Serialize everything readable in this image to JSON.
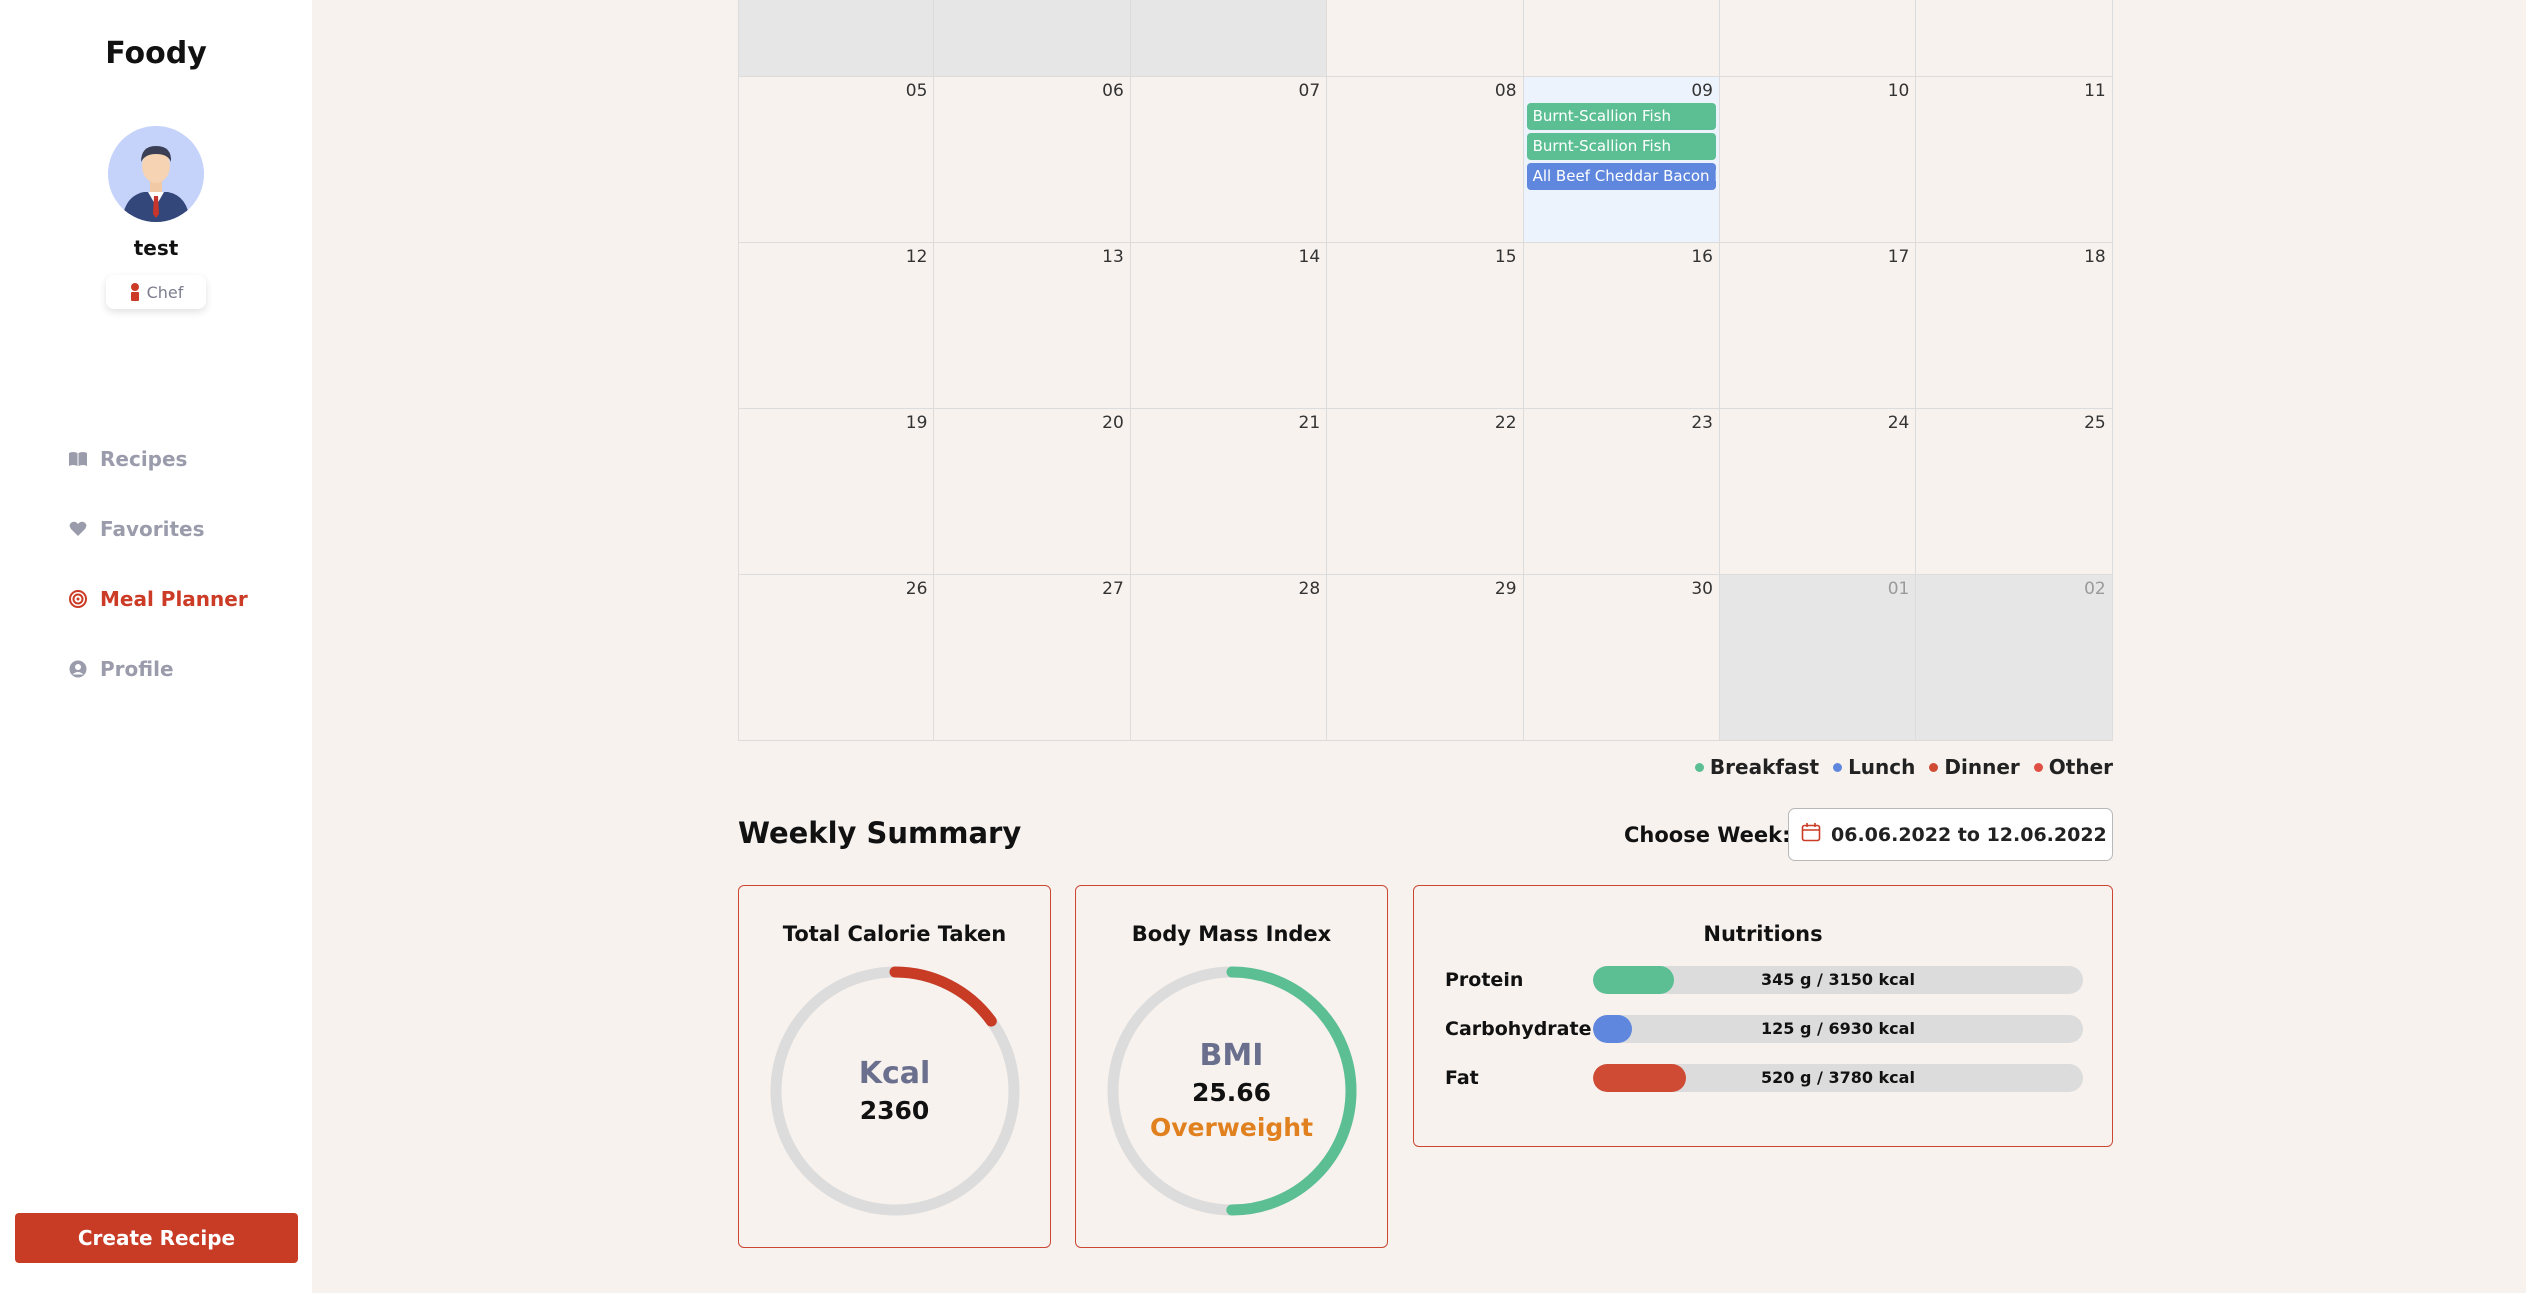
{
  "app": {
    "name": "Foody"
  },
  "user": {
    "name": "test",
    "role": "Chef"
  },
  "nav": [
    {
      "label": "Recipes",
      "icon": "book-icon",
      "active": false
    },
    {
      "label": "Favorites",
      "icon": "heart-icon",
      "active": false
    },
    {
      "label": "Meal Planner",
      "icon": "target-icon",
      "active": true
    },
    {
      "label": "Profile",
      "icon": "user-circle-icon",
      "active": false
    }
  ],
  "create_recipe_label": "Create Recipe",
  "calendar": {
    "weeks": [
      [
        {
          "day": "",
          "other": true
        },
        {
          "day": "",
          "other": true
        },
        {
          "day": "",
          "other": true
        },
        {
          "day": ""
        },
        {
          "day": ""
        },
        {
          "day": ""
        },
        {
          "day": ""
        }
      ],
      [
        {
          "day": "05"
        },
        {
          "day": "06"
        },
        {
          "day": "07"
        },
        {
          "day": "08"
        },
        {
          "day": "09",
          "today": true,
          "events": [
            {
              "title": "Burnt-Scallion Fish",
              "type": "Breakfast"
            },
            {
              "title": "Burnt-Scallion Fish",
              "type": "Breakfast"
            },
            {
              "title": "All Beef Cheddar Bacon Burger",
              "type": "Lunch"
            }
          ]
        },
        {
          "day": "10"
        },
        {
          "day": "11"
        }
      ],
      [
        {
          "day": "12"
        },
        {
          "day": "13"
        },
        {
          "day": "14"
        },
        {
          "day": "15"
        },
        {
          "day": "16"
        },
        {
          "day": "17"
        },
        {
          "day": "18"
        }
      ],
      [
        {
          "day": "19"
        },
        {
          "day": "20"
        },
        {
          "day": "21"
        },
        {
          "day": "22"
        },
        {
          "day": "23"
        },
        {
          "day": "24"
        },
        {
          "day": "25"
        }
      ],
      [
        {
          "day": "26"
        },
        {
          "day": "27"
        },
        {
          "day": "28"
        },
        {
          "day": "29"
        },
        {
          "day": "30"
        },
        {
          "day": "01",
          "other": true
        },
        {
          "day": "02",
          "other": true
        }
      ]
    ]
  },
  "legend": [
    {
      "label": "Breakfast",
      "color": "#5cbf94"
    },
    {
      "label": "Lunch",
      "color": "#5f87de"
    },
    {
      "label": "Dinner",
      "color": "#cf4b33"
    },
    {
      "label": "Other",
      "color": "#e04f43"
    }
  ],
  "weekly_summary": {
    "title": "Weekly Summary",
    "choose_week_label": "Choose Week:",
    "week_range": "06.06.2022 to 12.06.2022",
    "calories": {
      "title": "Total Calorie Taken",
      "unit": "Kcal",
      "value": "2360",
      "progress": 0.15,
      "color": "#c83b25"
    },
    "bmi": {
      "title": "Body Mass Index",
      "label": "BMI",
      "value": "25.66",
      "status": "Overweight",
      "progress": 0.5,
      "color": "#5cbf94",
      "status_color": "#e0801e"
    },
    "nutrition": {
      "title": "Nutritions",
      "items": [
        {
          "label": "Protein",
          "text": "345 g / 3150 kcal",
          "fraction": 0.165,
          "color": "#5cbf94"
        },
        {
          "label": "Carbohydrate",
          "text": "125 g / 6930 kcal",
          "fraction": 0.08,
          "color": "#5f87de"
        },
        {
          "label": "Fat",
          "text": "520 g / 3780 kcal",
          "fraction": 0.19,
          "color": "#cf4b33"
        }
      ]
    }
  }
}
